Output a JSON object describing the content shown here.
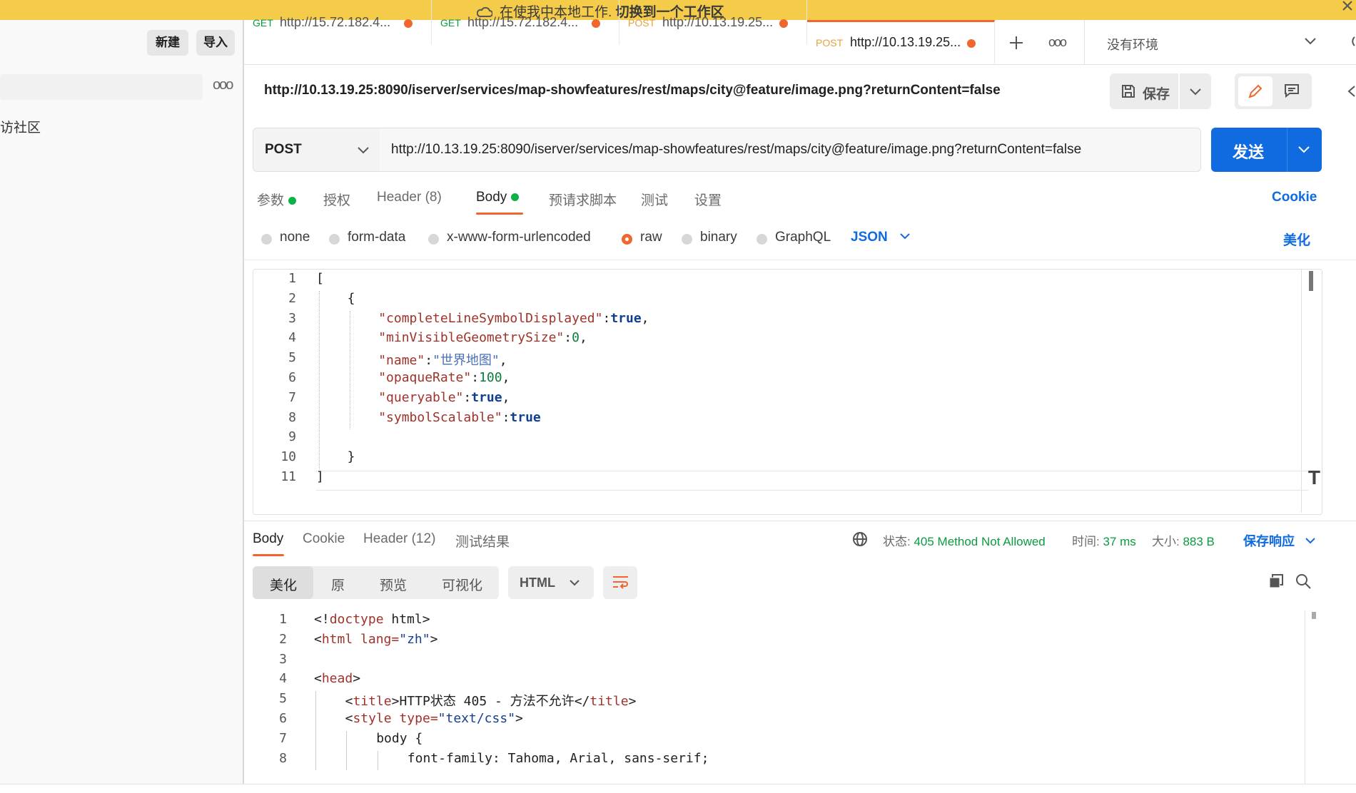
{
  "banner": {
    "text": "在使我中本地工作.",
    "link": "切换到一个工作区"
  },
  "sidebar": {
    "new_label": "新建",
    "import_label": "导入",
    "more_icon": "more-icon",
    "partial_item": "访社区"
  },
  "tabs": [
    {
      "method": "GET",
      "url": "http://15.72.182.4...",
      "method_color": "#0a9b40"
    },
    {
      "method": "GET",
      "url": "http://15.72.182.4...",
      "method_color": "#0a9b40"
    },
    {
      "method": "POST",
      "url": "http://10.13.19.25...",
      "method_color": "#e6a23c"
    },
    {
      "method": "POST",
      "url": "http://10.13.19.25...",
      "method_color": "#e6a23c"
    }
  ],
  "environment": "没有环境",
  "request": {
    "title": "http://10.13.19.25:8090/iserver/services/map-showfeatures/rest/maps/city@feature/image.png?returnContent=false",
    "method": "POST",
    "url": "http://10.13.19.25:8090/iserver/services/map-showfeatures/rest/maps/city@feature/image.png?returnContent=false",
    "save_label": "保存",
    "send_label": "发送",
    "tabs": {
      "params": "参数",
      "auth": "授权",
      "header": "Header",
      "header_count": "(8)",
      "body": "Body",
      "prerequest": "预请求脚本",
      "tests": "测试",
      "settings": "设置",
      "cookie": "Cookie"
    },
    "body_types": {
      "none": "none",
      "form_data": "form-data",
      "urlencoded": "x-www-form-urlencoded",
      "raw": "raw",
      "binary": "binary",
      "graphql": "GraphQL",
      "json": "JSON",
      "beautify": "美化"
    }
  },
  "request_body_lines": [
    {
      "n": "1",
      "t": "["
    },
    {
      "n": "2",
      "t": "{"
    },
    {
      "n": "3",
      "k": "\"completeLineSymbolDisplayed\"",
      "v": "true",
      "vt": "kw",
      "c": ","
    },
    {
      "n": "4",
      "k": "\"minVisibleGeometrySize\"",
      "v": "0",
      "vt": "num",
      "c": ","
    },
    {
      "n": "5",
      "k": "\"name\"",
      "v": "\"世界地图\"",
      "vt": "str",
      "c": ","
    },
    {
      "n": "6",
      "k": "\"opaqueRate\"",
      "v": "100",
      "vt": "num",
      "c": ","
    },
    {
      "n": "7",
      "k": "\"queryable\"",
      "v": "true",
      "vt": "kw",
      "c": ","
    },
    {
      "n": "8",
      "k": "\"symbolScalable\"",
      "v": "true",
      "vt": "kw",
      "c": ""
    },
    {
      "n": "9",
      "t": ""
    },
    {
      "n": "10",
      "t": "}"
    },
    {
      "n": "11",
      "t": "]"
    }
  ],
  "response": {
    "tabs": {
      "body": "Body",
      "cookie": "Cookie",
      "header": "Header",
      "header_count": "(12)",
      "test_results": "测试结果"
    },
    "status_label": "状态:",
    "status_value": "405 Method Not Allowed",
    "time_label": "时间:",
    "time_value": "37 ms",
    "size_label": "大小:",
    "size_value": "883 B",
    "save_response": "保存响应",
    "formats": {
      "pretty": "美化",
      "raw": "原",
      "preview": "预览",
      "visualize": "可视化",
      "html": "HTML"
    }
  },
  "response_lines": [
    {
      "n": "1",
      "html": "<!doctype html>"
    },
    {
      "n": "2",
      "html": "<html lang=\"zh\">"
    },
    {
      "n": "3",
      "html": ""
    },
    {
      "n": "4",
      "html": "<head>"
    },
    {
      "n": "5",
      "html": "<title>HTTP状态 405 - 方法不允许</title>"
    },
    {
      "n": "6",
      "html": "<style type=\"text/css\">"
    },
    {
      "n": "7",
      "html": "body {"
    },
    {
      "n": "8",
      "html": "font-family: Tahoma, Arial, sans-serif;"
    }
  ]
}
